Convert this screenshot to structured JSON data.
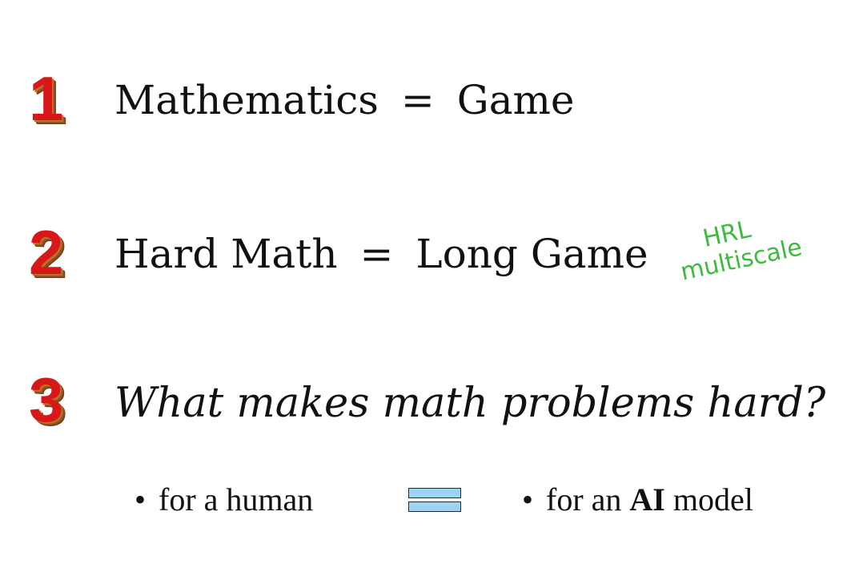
{
  "items": [
    {
      "number": "1",
      "left": "Mathematics",
      "operator": "=",
      "right": "Game"
    },
    {
      "number": "2",
      "left": "Hard Math",
      "operator": "=",
      "right": "Long Game"
    },
    {
      "number": "3",
      "question": "What makes math problems hard?"
    }
  ],
  "bullets": {
    "left": {
      "marker": "•",
      "text": "for a human"
    },
    "right": {
      "marker": "•",
      "text_prefix": "for an",
      "text_bold": "AI",
      "text_suffix": "model"
    }
  },
  "annotation": {
    "line1": "HRL",
    "line2": "multiscale",
    "color": "#3dbb3d"
  },
  "colors": {
    "number_red": "#d81818",
    "number_shadow": "#8a5220",
    "equiv_fill": "#9fd3f2"
  },
  "icons": {
    "equivalence": "equals-sign-icon"
  }
}
